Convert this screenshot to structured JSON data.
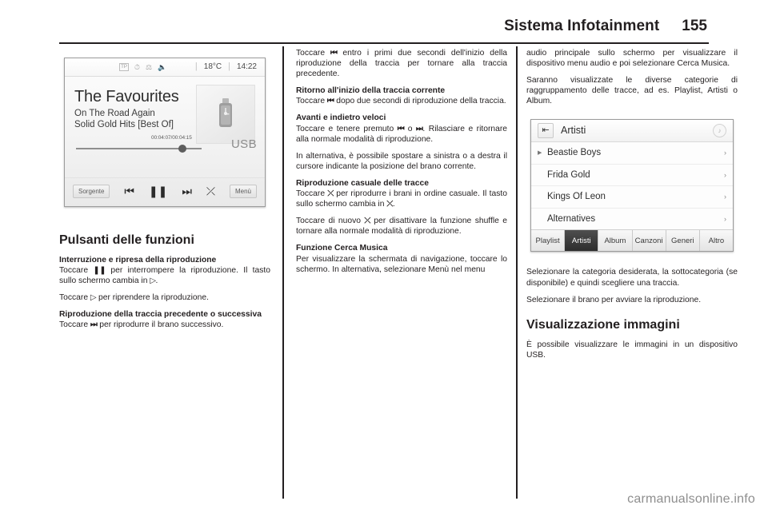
{
  "header": {
    "title": "Sistema Infotainment",
    "page_number": "155"
  },
  "figure_player": {
    "status_bar": {
      "tp_badge": "TP",
      "icons": [
        "clock-icon",
        "bluetooth-icon",
        "mute-icon"
      ],
      "temperature": "18°C",
      "time": "14:22",
      "separator": "|"
    },
    "track_title": "The Favourites",
    "track_line2": "On The Road Again",
    "track_line3": "Solid Gold Hits [Best Of]",
    "time_elapsed_total": "00:04:07/00:04:15",
    "source_label": "USB",
    "controls": {
      "source_button": "Sorgente",
      "previous": "⏮",
      "pause": "❚❚",
      "next": "⏭",
      "shuffle": "⤫",
      "menu_button": "Menù"
    }
  },
  "figure_artisti": {
    "back_icon": "⇤",
    "title": "Artisti",
    "note_icon": "♪",
    "rows": [
      {
        "label": "Beastie Boys",
        "playing": true,
        "chevron": "›"
      },
      {
        "label": "Frida Gold",
        "playing": false,
        "chevron": "›"
      },
      {
        "label": "Kings Of Leon",
        "playing": false,
        "chevron": "›"
      },
      {
        "label": "Alternatives",
        "playing": false,
        "chevron": "›"
      }
    ],
    "tabs": [
      {
        "label": "Playlist",
        "active": false
      },
      {
        "label": "Artisti",
        "active": true
      },
      {
        "label": "Album",
        "active": false
      },
      {
        "label": "Canzoni",
        "active": false
      },
      {
        "label": "Generi",
        "active": false
      },
      {
        "label": "Altro",
        "active": false
      }
    ]
  },
  "column1": {
    "heading": "Pulsanti delle funzioni",
    "sub1": "Interruzione e ripresa della riproduzione",
    "p1_a": "Toccare ",
    "p1_sym1": "❚❚",
    "p1_b": " per interrompere la riproduzione. Il tasto sullo schermo cambia in ",
    "p1_sym2": "▷",
    "p1_c": ".",
    "p2_a": "Toccare ",
    "p2_sym": "▷",
    "p2_b": " per riprendere la riproduzione.",
    "sub2": "Riproduzione della traccia precedente o successiva",
    "p3_a": "Toccare ",
    "p3_sym": "⏭",
    "p3_b": " per riprodurre il brano successivo."
  },
  "column2": {
    "p1_a": "Toccare ",
    "p1_sym": "⏮",
    "p1_b": " entro i primi due secondi dell'inizio della riproduzione della traccia per tornare alla traccia precedente.",
    "sub1": "Ritorno all'inizio della traccia corrente",
    "p2_a": "Toccare ",
    "p2_sym": "⏮",
    "p2_b": " dopo due secondi di riproduzione della traccia.",
    "sub2": "Avanti e indietro veloci",
    "p3_a": "Toccare e tenere premuto ",
    "p3_sym1": "⏮",
    "p3_b": " o ",
    "p3_sym2": "⏭",
    "p3_c": ". Rilasciare e ritornare alla normale modalità di riproduzione.",
    "p4": "In alternativa, è possibile spostare a sinistra o a destra il cursore indicante la posizione del brano corrente.",
    "sub3": "Riproduzione casuale delle tracce",
    "p5_a": "Toccare ",
    "p5_sym1": "⤫",
    "p5_b": " per riprodurre i brani in ordine casuale. Il tasto sullo schermo cambia in ",
    "p5_sym2": "⤫",
    "p5_c": ".",
    "p6_a": "Toccare di nuovo ",
    "p6_sym": "⤫",
    "p6_b": " per disattivare la funzione shuffle e tornare alla normale modalità di riproduzione.",
    "sub4": "Funzione Cerca Musica",
    "p7": "Per visualizzare la schermata di navigazione, toccare lo schermo. In alternativa, selezionare Menù nel menu"
  },
  "column3": {
    "p1": "audio principale sullo schermo per visualizzare il dispositivo menu audio e poi selezionare Cerca Musica.",
    "p2": "Saranno visualizzate le diverse categorie di raggruppamento delle tracce, ad es. Playlist, Artisti o Album.",
    "p3": "Selezionare la categoria desiderata, la sottocategoria (se disponibile) e quindi scegliere una traccia.",
    "p4": "Selezionare il brano per avviare la riproduzione.",
    "heading": "Visualizzazione immagini",
    "p5": "È possibile visualizzare le immagini in un dispositivo USB."
  },
  "watermark": "carmanualsonline.info"
}
